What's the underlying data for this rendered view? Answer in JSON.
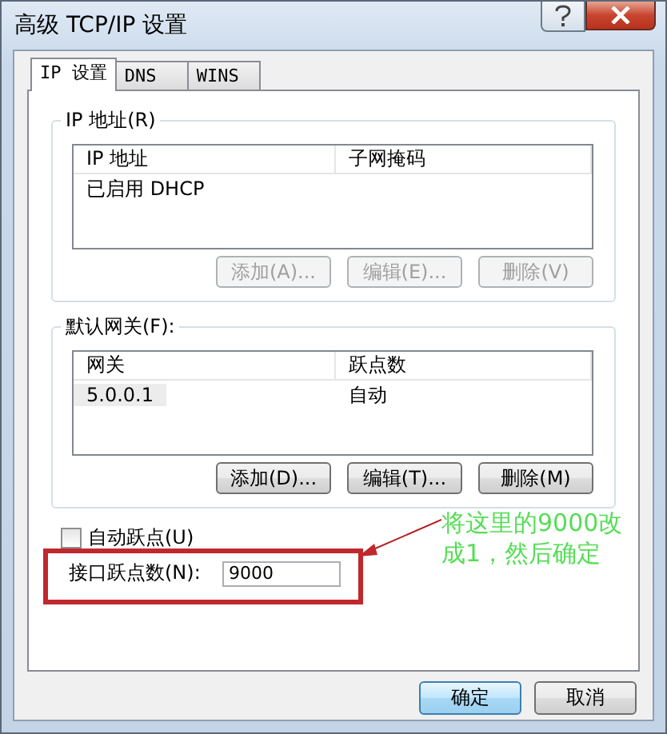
{
  "window": {
    "title": "高级 TCP/IP 设置"
  },
  "tabs": [
    {
      "label": "IP 设置",
      "selected": true
    },
    {
      "label": "DNS",
      "selected": false
    },
    {
      "label": "WINS",
      "selected": false
    }
  ],
  "ip_group": {
    "label": "IP 地址(R)",
    "columns": [
      "IP 地址",
      "子网掩码"
    ],
    "rows": [
      {
        "cells": [
          "已启用 DHCP"
        ],
        "selected": false
      }
    ],
    "buttons": [
      {
        "label": "添加(A)...",
        "disabled": true
      },
      {
        "label": "编辑(E)...",
        "disabled": true
      },
      {
        "label": "删除(V)",
        "disabled": true
      }
    ]
  },
  "gateway_group": {
    "label": "默认网关(F):",
    "columns": [
      "网关",
      "跃点数"
    ],
    "rows": [
      {
        "cells": [
          "5.0.0.1",
          "自动"
        ],
        "selected": true
      }
    ],
    "buttons": [
      {
        "label": "添加(D)...",
        "disabled": false
      },
      {
        "label": "编辑(T)...",
        "disabled": false
      },
      {
        "label": "删除(M)",
        "disabled": false
      }
    ]
  },
  "auto_metric": {
    "label": "自动跃点(U)",
    "checked": false
  },
  "interface_metric": {
    "label": "接口跃点数(N):",
    "value": "9000"
  },
  "annotation": {
    "lines": [
      "将这里的9000改",
      "成1，然后确定"
    ]
  },
  "footer": [
    {
      "label": "确定",
      "default": true
    },
    {
      "label": "取消",
      "default": false
    }
  ]
}
